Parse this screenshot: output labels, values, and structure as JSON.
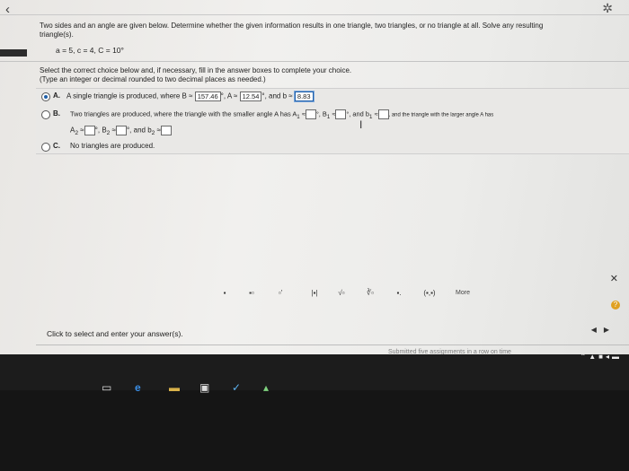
{
  "header": {
    "back_icon": "chevron-left-icon",
    "settings_icon": "gear-icon"
  },
  "problem": {
    "question": "Two sides and an angle are given below. Determine whether the given information results in one triangle, two triangles, or no triangle at all. Solve any resulting triangle(s).",
    "given": "a = 5, c = 4, C = 10°",
    "instruction": "Select the correct choice below and, if necessary, fill in the answer boxes to complete your choice.",
    "instruction_note": "(Type an integer or decimal rounded to two decimal places as needed.)"
  },
  "choices": {
    "a": {
      "letter": "A.",
      "text_prefix": "A single triangle is produced, where B ≈",
      "B_value": "157.46",
      "A_prefix": "°, A ≈",
      "A_value": "12.54",
      "b_prefix": "°, and b ≈",
      "b_value": "8.83",
      "selected": true
    },
    "b": {
      "letter": "B.",
      "line1_prefix": "Two triangles are produced, where the triangle with the smaller angle A has A",
      "sub1": "1",
      "approx": "≈",
      "deg_comma_B1": "°, B",
      "deg_comma_b1": "°, and b",
      "line1_suffix": ", and the triangle with the larger angle A has",
      "A2": "A",
      "sub2": "2",
      "deg_comma_B2": "°, B",
      "deg_comma_b2": "°, and b",
      "selected": false
    },
    "c": {
      "letter": "C.",
      "text": "No triangles are produced.",
      "selected": false
    }
  },
  "toolbar": {
    "more_label": "More",
    "tools": [
      "fraction-icon",
      "mixed-number-icon",
      "exponent-icon",
      "absolute-value-icon",
      "sqrt-icon",
      "nth-root-icon",
      "decimal-icon",
      "interval-icon"
    ],
    "tool_glyphs": [
      "▪",
      "▪▫",
      "▫'",
      "|▪|",
      "√▫",
      "∛▫",
      "▪.",
      "(▪,▪)"
    ]
  },
  "footer": {
    "hint": "Click to select and enter your answer(s).",
    "submitted": "Submitted five assignments in a row on time"
  }
}
